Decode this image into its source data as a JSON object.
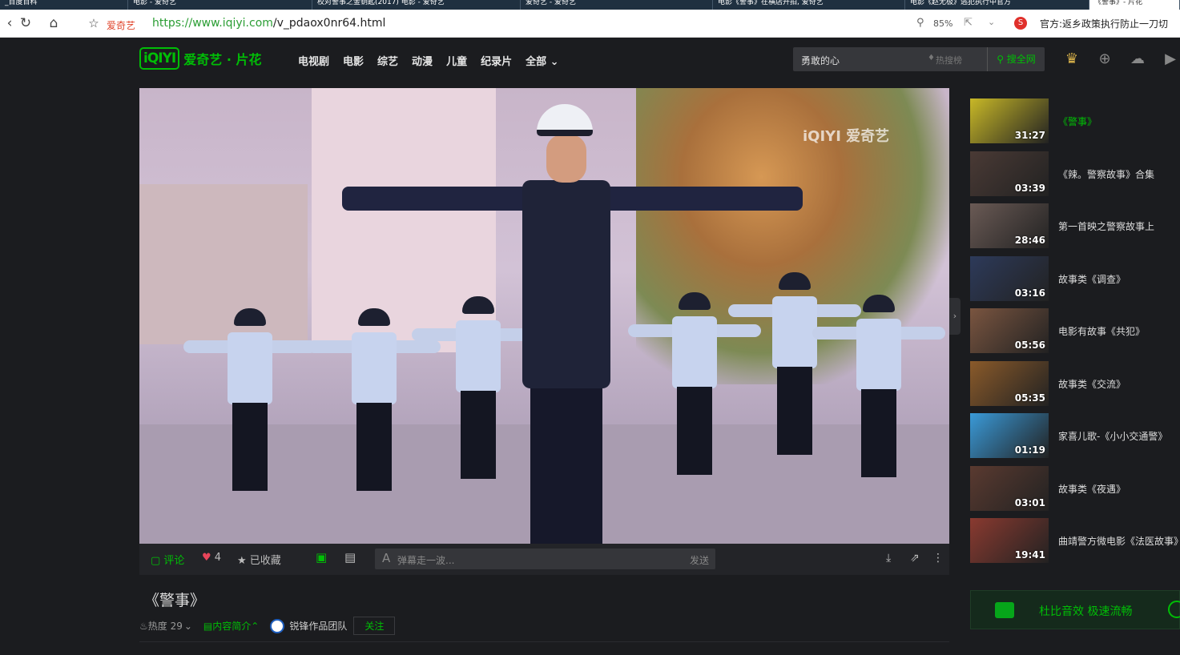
{
  "browser": {
    "tabs": [
      {
        "label": "_百度百科",
        "active": false
      },
      {
        "label": "电影 - 爱奇艺",
        "active": false
      },
      {
        "label": "校对警事之金钥匙(2017) 电影 - 爱奇艺",
        "active": false
      },
      {
        "label": "爱奇艺 - 爱奇艺",
        "active": false
      },
      {
        "label": "电影《警事》在横店开拍, 爱奇艺",
        "active": false
      },
      {
        "label": "电影《赵无极》逃犯执行中官方",
        "active": false
      },
      {
        "label": "《警事》- 片花",
        "active": true
      }
    ],
    "url_prefix": "https://",
    "url_host": "www.iqiyi.com",
    "url_path": "/v_pdaox0nr64.html",
    "bookmark_label": "爱奇艺",
    "zoom": "85%",
    "news": "官方:返乡政策执行防止一刀切"
  },
  "header": {
    "logo": "iQIYI",
    "logo_suffix": "爱奇艺 · 片花",
    "nav": [
      "电视剧",
      "电影",
      "综艺",
      "动漫",
      "儿童",
      "纪录片",
      "全部 ⌄"
    ],
    "search_query": "勇敢的心",
    "hot_label": "热搜榜",
    "search_button": "搜全网"
  },
  "player": {
    "watermark": "iQIYI 爱奇艺"
  },
  "controls": {
    "comment": "评论",
    "likes": "4",
    "collected": "已收藏",
    "danmaku_placeholder": "弹幕走一波...",
    "send": "发送"
  },
  "video": {
    "title": "《警事》",
    "heat": "热度 29",
    "intro": "内容简介",
    "uploader": "锐锋作品团队",
    "follow": "关注"
  },
  "playlist": [
    {
      "title": "《警事》",
      "duration": "31:27",
      "current": true,
      "color": "#c8b827"
    },
    {
      "title": "《辣。警察故事》合集",
      "duration": "03:39",
      "current": false,
      "color": "#4a3a35"
    },
    {
      "title": "第一首映之警察故事上",
      "duration": "28:46",
      "current": false,
      "color": "#6a5a55"
    },
    {
      "title": "故事类《调查》",
      "duration": "03:16",
      "current": false,
      "color": "#2d3a5a"
    },
    {
      "title": "电影有故事《共犯》",
      "duration": "05:56",
      "current": false,
      "color": "#7a5540"
    },
    {
      "title": "故事类《交流》",
      "duration": "05:35",
      "current": false,
      "color": "#8a5a2a"
    },
    {
      "title": "家喜儿歌-《小小交通警》",
      "duration": "01:19",
      "current": false,
      "color": "#3a9ad8"
    },
    {
      "title": "故事类《夜遇》",
      "duration": "03:01",
      "current": false,
      "color": "#5a3a30"
    },
    {
      "title": "曲靖警方微电影《法医故事》",
      "duration": "19:41",
      "current": false,
      "color": "#8a3a30"
    }
  ],
  "promo": {
    "text": "杜比音效  极速流畅"
  }
}
